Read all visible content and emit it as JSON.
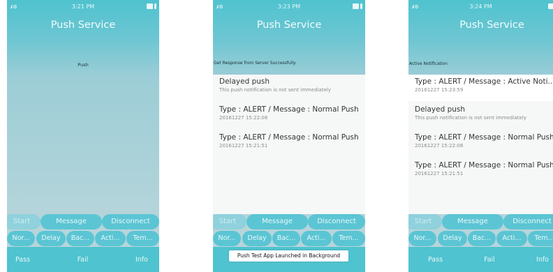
{
  "status": {
    "signal": ".ıl ⚙"
  },
  "screens": [
    {
      "time": "3:21 PM",
      "title": "Push Service",
      "message": "Push",
      "items": [],
      "buttons_row1": [
        "Start",
        "Message",
        "Disconnect"
      ],
      "buttons_row2": [
        "Nor...",
        "Delay",
        "Bac...",
        "Acti...",
        "Tem..."
      ],
      "bottom": [
        "Pass",
        "Fail",
        "Info"
      ]
    },
    {
      "time": "3:23 PM",
      "title": "Push Service",
      "message": "Get Response from Server Successfully",
      "items": [
        {
          "title": "Delayed push",
          "sub": "This push notification is not sent immediately"
        },
        {
          "title": "Type : ALERT / Message : Normal Push",
          "sub": "20161227 15:22:08"
        },
        {
          "title": "Type : ALERT / Message : Normal Push",
          "sub": "20161227 15:21:51"
        }
      ],
      "buttons_row1": [
        "Start",
        "Message",
        "Disconnect"
      ],
      "buttons_row2": [
        "Nor...",
        "Delay",
        "Bac...",
        "Acti...",
        "Tem..."
      ],
      "toast": "Push Test App Launched in Background"
    },
    {
      "time": "3:24 PM",
      "title": "Push Service",
      "message": "Active Notification",
      "items": [
        {
          "title": "Type : ALERT / Message : Active Noti...",
          "sub": "20161227 15:23:59"
        },
        {
          "title": "Delayed push",
          "sub": "This push notification is not sent immediately"
        },
        {
          "title": "Type : ALERT / Message : Normal Push",
          "sub": "20161227 15:22:08"
        },
        {
          "title": "Type : ALERT / Message : Normal Push",
          "sub": "20161227 15:21:51"
        }
      ],
      "buttons_row1": [
        "Start",
        "Message",
        "Disconnect"
      ],
      "buttons_row2": [
        "Nor...",
        "Delay",
        "Bac...",
        "Acti...",
        "Tem..."
      ],
      "bottom": [
        "Pass",
        "Fail",
        "Info"
      ]
    }
  ]
}
